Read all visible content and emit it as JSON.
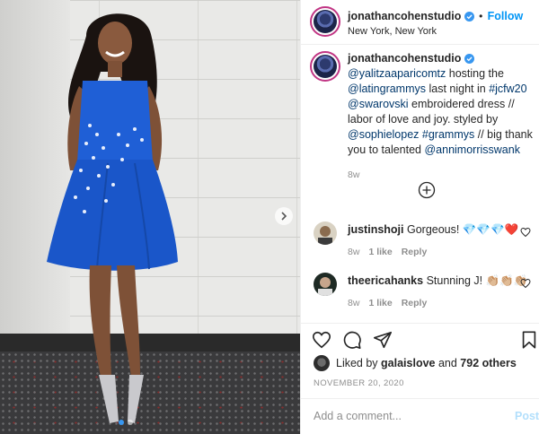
{
  "post": {
    "account": "jonathancohenstudio",
    "follow_label": "Follow",
    "separator": "•",
    "location": "New York, New York",
    "caption_parts": {
      "mention1": "@yalitzaaparicomtz",
      "text1": " hosting the ",
      "mention2": "@latingrammys",
      "text2": " last night in ",
      "tag1": "#jcfw20",
      "text3": " ",
      "mention3": "@swarovski",
      "text4": " embroidered dress // labor of love and joy. styled by ",
      "mention4": "@sophielopez",
      "text5": " ",
      "tag2": "#grammys",
      "text6": " // big thank you to talented ",
      "mention5": "@annimorrisswank"
    },
    "caption_time": "8w",
    "likes": {
      "prefix": "Liked by ",
      "user": "galaislove",
      "middle": " and ",
      "count": "792 others"
    },
    "date": "NOVEMBER 20, 2020",
    "comment_placeholder": "Add a comment...",
    "post_label": "Post"
  },
  "comments": [
    {
      "user": "justinshoji",
      "text": "Gorgeous! 💎💎💎❤️",
      "time": "8w",
      "likes": "1 like",
      "reply": "Reply"
    },
    {
      "user": "theericahanks",
      "text": "Stunning J! 👏🏼👏🏼👏🏼",
      "time": "8w",
      "likes": "1 like",
      "reply": "Reply"
    }
  ],
  "icons": {
    "verified": "verified-badge-icon",
    "load_more": "plus-circle-icon",
    "like": "heart-icon",
    "comment": "comment-bubble-icon",
    "share": "paper-plane-icon",
    "save": "bookmark-icon",
    "carousel_next": "chevron-right-icon"
  },
  "colors": {
    "accent": "#0095f6",
    "link": "#00376b",
    "dress": "#1f5fd6",
    "verified": "#3897f0"
  }
}
